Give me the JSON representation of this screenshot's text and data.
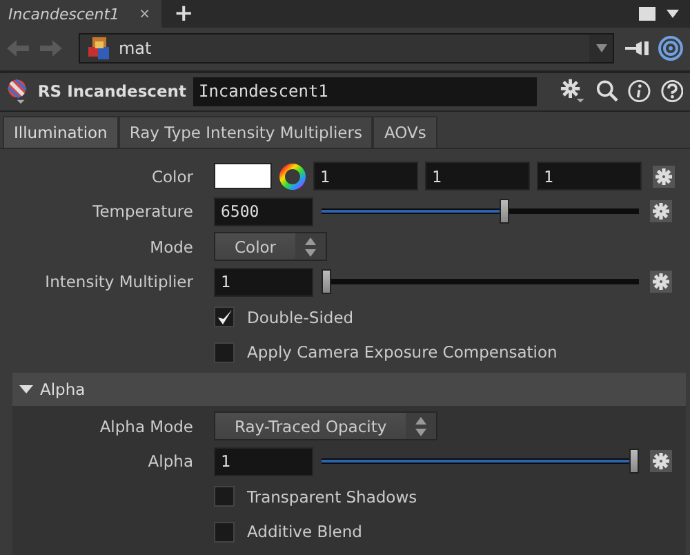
{
  "pane_tabs": [
    {
      "label": "Incandescent1",
      "close": "×",
      "selected": true
    }
  ],
  "add_tab": "+",
  "path": {
    "value": "mat"
  },
  "node": {
    "type": "RS Incandescent",
    "name": "Incandescent1"
  },
  "tabs": [
    {
      "label": "Illumination",
      "selected": true
    },
    {
      "label": "Ray Type Intensity Multipliers",
      "selected": false
    },
    {
      "label": "AOVs",
      "selected": false
    }
  ],
  "params": [
    {
      "kind": "color",
      "label": "Color",
      "values": [
        "1",
        "1",
        "1"
      ]
    },
    {
      "kind": "slider",
      "label": "Temperature",
      "value": "6500",
      "level": 0.58
    },
    {
      "kind": "menu",
      "label": "Mode",
      "value": "Color"
    },
    {
      "kind": "slider",
      "label": "Intensity Multiplier",
      "value": "1",
      "level": 0
    },
    {
      "kind": "checkbox",
      "label": "Double-Sided",
      "checked": true
    },
    {
      "kind": "checkbox",
      "label": "Apply Camera Exposure Compensation",
      "checked": false
    }
  ],
  "folder": {
    "label": "Alpha",
    "expanded": true,
    "params": [
      {
        "kind": "menu",
        "label": "Alpha Mode",
        "value": "Ray-Traced Opacity"
      },
      {
        "kind": "slider",
        "label": "Alpha",
        "value": "1",
        "level": 1
      },
      {
        "kind": "checkbox",
        "label": "Transparent Shadows",
        "checked": false
      },
      {
        "kind": "checkbox",
        "label": "Additive Blend",
        "checked": false
      }
    ]
  }
}
